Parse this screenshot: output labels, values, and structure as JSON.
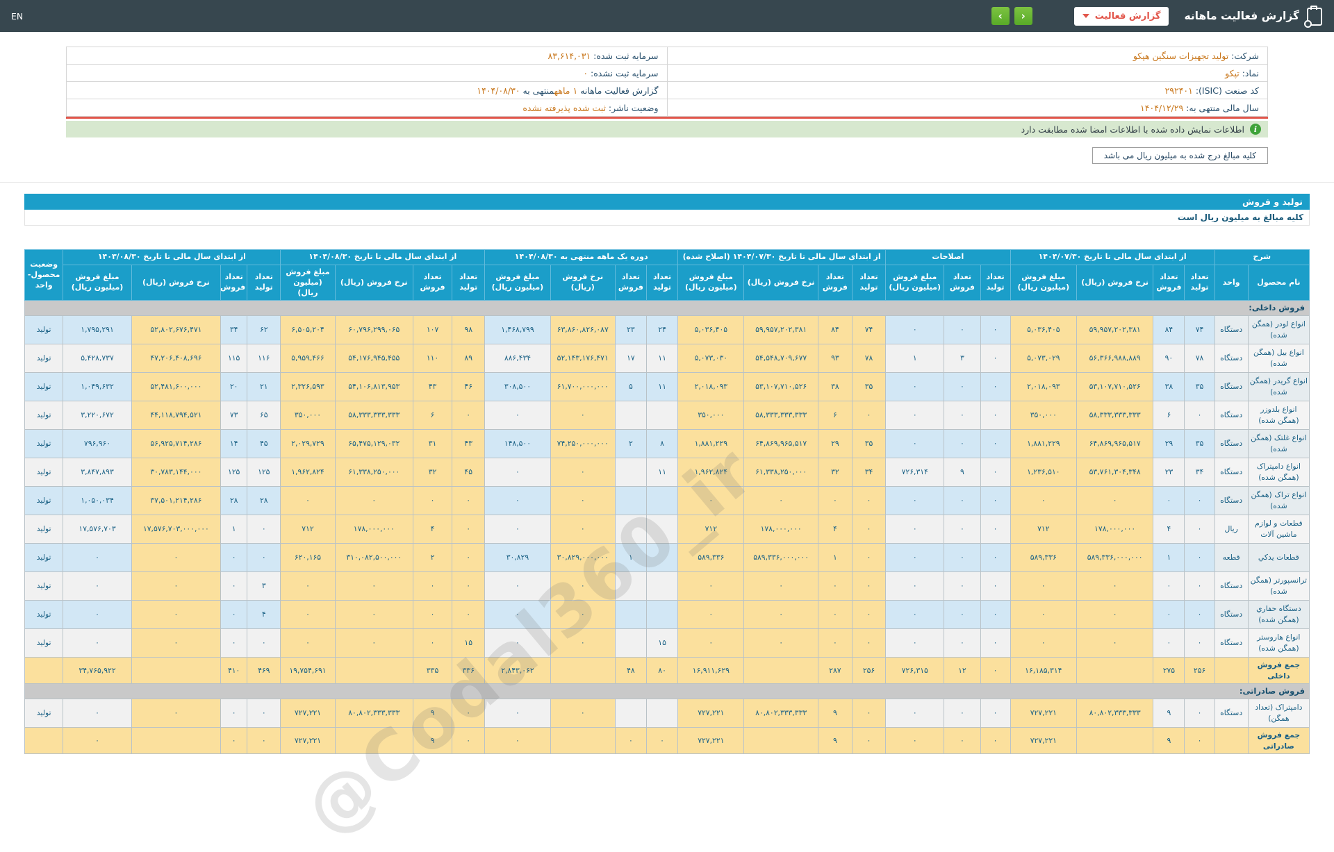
{
  "topbar": {
    "title": "گزارش فعالیت ماهانه",
    "dropdown_label": "گزارش فعالیت",
    "nav_next": "›",
    "nav_prev": "‹",
    "language": "EN"
  },
  "colors": {
    "accent_blue": "#1b9ec9",
    "topbar": "#37474f",
    "wheat": "#fbe09d",
    "row_blue": "#d2e7f5",
    "green_button": "#61b329",
    "red_accent": "#e2574c"
  },
  "company_info": {
    "rows": [
      {
        "right": {
          "key": "company",
          "parts": [
            {
              "k": "lbl",
              "t": "شرکت: "
            },
            {
              "k": "val",
              "t": "تولید تجهیزات سنگین هپکو"
            }
          ]
        },
        "left": {
          "key": "registered-capital",
          "parts": [
            {
              "k": "lbl",
              "t": "سرمایه ثبت شده: "
            },
            {
              "k": "val",
              "t": "۸۳,۶۱۴,۰۳۱"
            }
          ]
        }
      },
      {
        "right": {
          "key": "symbol",
          "parts": [
            {
              "k": "lbl",
              "t": "نماد: "
            },
            {
              "k": "val",
              "t": "تپکو"
            }
          ]
        },
        "left": {
          "key": "unregistered-capital",
          "parts": [
            {
              "k": "lbl",
              "t": "سرمایه ثبت نشده: "
            },
            {
              "k": "val",
              "t": "۰"
            }
          ]
        }
      },
      {
        "right": {
          "key": "isic-code",
          "parts": [
            {
              "k": "lbl",
              "t": "کد صنعت (ISIC): "
            },
            {
              "k": "val",
              "t": "۲۹۲۴۰۱"
            }
          ]
        },
        "left": {
          "key": "report-period",
          "parts": [
            {
              "k": "lbl",
              "t": "گزارش فعالیت ماهانه "
            },
            {
              "k": "val",
              "t": "۱ ماهه"
            },
            {
              "k": "lbl",
              "t": "منتهی به "
            },
            {
              "k": "val",
              "t": "۱۴۰۴/۰۸/۳۰"
            }
          ]
        }
      },
      {
        "right": {
          "key": "fiscal-year-end",
          "parts": [
            {
              "k": "lbl",
              "t": "سال مالی منتهی به: "
            },
            {
              "k": "val",
              "t": "۱۴۰۴/۱۲/۲۹"
            }
          ]
        },
        "left": {
          "key": "publisher-status",
          "parts": [
            {
              "k": "lbl",
              "t": "وضعیت ناشر: "
            },
            {
              "k": "val",
              "t": "ثبت شده پذیرفته نشده"
            }
          ]
        }
      }
    ]
  },
  "banner": {
    "text": "اطلاعات نمایش داده شده با اطلاعات امضا شده مطابقت دارد",
    "icon_glyph": "i"
  },
  "note_box": "کلیه مبالغ درج شده به میلیون ریال می باشد",
  "section_title": "تولید و فروش",
  "section_subtitle": "کلیه مبالغ به میلیون ریال است",
  "watermark": "@Codal360_ir",
  "table": {
    "header": {
      "desc_group": "شرح",
      "product": "نام محصول",
      "unit": "واحد",
      "status": "وضعیت محصول-واحد",
      "cols": {
        "prod": "تعداد تولید",
        "sold": "تعداد فروش",
        "rate": "نرخ فروش (ریال)",
        "amount": "مبلغ فروش (میلیون ریال)"
      },
      "groups": [
        {
          "key": "fy0730",
          "label": "از ابتدای سال مالی تا تاریخ ۱۴۰۴/۰۷/۳۰",
          "cols": 4
        },
        {
          "key": "adj",
          "label": "اصلاحات",
          "cols": 3
        },
        {
          "key": "fy0730c",
          "label": "از ابتدای سال مالی تا تاریخ ۱۴۰۴/۰۷/۳۰ (اصلاح شده)",
          "cols": 4
        },
        {
          "key": "month",
          "label": "دوره یک ماهه منتهی به ۱۴۰۴/۰۸/۳۰",
          "cols": 4
        },
        {
          "key": "fy0830",
          "label": "از ابتدای سال مالی تا تاریخ ۱۴۰۴/۰۸/۳۰",
          "cols": 4
        },
        {
          "key": "py0830",
          "label": "از ابتدای سال مالی تا تاریخ ۱۴۰۳/۰۸/۳۰",
          "cols": 4
        }
      ]
    },
    "rows": [
      {
        "type": "section",
        "name": "فروش داخلی:"
      },
      {
        "type": "data",
        "z": "a",
        "name": "انواع لودر (همگن شده)",
        "unit": "دستگاه",
        "status": "تولید",
        "fy0730": [
          "۷۴",
          "۸۴",
          "۵۹,۹۵۷,۲۰۲,۳۸۱",
          "۵,۰۳۶,۴۰۵"
        ],
        "adj": [
          "۰",
          "۰",
          "۰"
        ],
        "fy0730c": [
          "۷۴",
          "۸۴",
          "۵۹,۹۵۷,۲۰۲,۳۸۱",
          "۵,۰۳۶,۴۰۵"
        ],
        "month": [
          "۲۴",
          "۲۳",
          "۶۳,۸۶۰,۸۲۶,۰۸۷",
          "۱,۴۶۸,۷۹۹"
        ],
        "fy0830": [
          "۹۸",
          "۱۰۷",
          "۶۰,۷۹۶,۲۹۹,۰۶۵",
          "۶,۵۰۵,۲۰۴"
        ],
        "py0830": [
          "۶۲",
          "۳۴",
          "۵۲,۸۰۲,۶۷۶,۴۷۱",
          "۱,۷۹۵,۲۹۱"
        ]
      },
      {
        "type": "data",
        "z": "b",
        "name": "انواع بیل (همگن شده)",
        "unit": "دستگاه",
        "status": "تولید",
        "fy0730": [
          "۷۸",
          "۹۰",
          "۵۶,۳۶۶,۹۸۸,۸۸۹",
          "۵,۰۷۳,۰۲۹"
        ],
        "adj": [
          "۰",
          "۳",
          "۱"
        ],
        "fy0730c": [
          "۷۸",
          "۹۳",
          "۵۴,۵۴۸,۷۰۹,۶۷۷",
          "۵,۰۷۳,۰۳۰"
        ],
        "month": [
          "۱۱",
          "۱۷",
          "۵۲,۱۴۳,۱۷۶,۴۷۱",
          "۸۸۶,۴۳۴"
        ],
        "fy0830": [
          "۸۹",
          "۱۱۰",
          "۵۴,۱۷۶,۹۴۵,۴۵۵",
          "۵,۹۵۹,۴۶۶"
        ],
        "py0830": [
          "۱۱۶",
          "۱۱۵",
          "۴۷,۲۰۶,۴۰۸,۶۹۶",
          "۵,۴۲۸,۷۳۷"
        ]
      },
      {
        "type": "data",
        "z": "a",
        "name": "انواع گریدر (همگن شده)",
        "unit": "دستگاه",
        "status": "تولید",
        "fy0730": [
          "۳۵",
          "۳۸",
          "۵۳,۱۰۷,۷۱۰,۵۲۶",
          "۲,۰۱۸,۰۹۳"
        ],
        "adj": [
          "۰",
          "۰",
          "۰"
        ],
        "fy0730c": [
          "۳۵",
          "۳۸",
          "۵۳,۱۰۷,۷۱۰,۵۲۶",
          "۲,۰۱۸,۰۹۳"
        ],
        "month": [
          "۱۱",
          "۵",
          "۶۱,۷۰۰,۰۰۰,۰۰۰",
          "۳۰۸,۵۰۰"
        ],
        "fy0830": [
          "۴۶",
          "۴۳",
          "۵۴,۱۰۶,۸۱۳,۹۵۳",
          "۲,۳۲۶,۵۹۳"
        ],
        "py0830": [
          "۲۱",
          "۲۰",
          "۵۲,۴۸۱,۶۰۰,۰۰۰",
          "۱,۰۴۹,۶۳۲"
        ]
      },
      {
        "type": "data",
        "z": "b",
        "name": "انواع بلدوزر (همگن شده)",
        "unit": "دستگاه",
        "status": "تولید",
        "fy0730": [
          "۰",
          "۶",
          "۵۸,۳۳۳,۳۳۳,۳۳۳",
          "۳۵۰,۰۰۰"
        ],
        "adj": [
          "۰",
          "۰",
          "۰"
        ],
        "fy0730c": [
          "۰",
          "۶",
          "۵۸,۳۳۳,۳۳۳,۳۳۳",
          "۳۵۰,۰۰۰"
        ],
        "month": [
          "",
          "",
          "۰",
          "۰"
        ],
        "fy0830": [
          "۰",
          "۶",
          "۵۸,۳۳۳,۳۳۳,۳۳۳",
          "۳۵۰,۰۰۰"
        ],
        "py0830": [
          "۶۵",
          "۷۳",
          "۴۴,۱۱۸,۷۹۴,۵۲۱",
          "۳,۲۲۰,۶۷۲"
        ]
      },
      {
        "type": "data",
        "z": "a",
        "name": "انواع غلتک (همگن شده)",
        "unit": "دستگاه",
        "status": "تولید",
        "fy0730": [
          "۳۵",
          "۲۹",
          "۶۴,۸۶۹,۹۶۵,۵۱۷",
          "۱,۸۸۱,۲۲۹"
        ],
        "adj": [
          "۰",
          "۰",
          "۰"
        ],
        "fy0730c": [
          "۳۵",
          "۲۹",
          "۶۴,۸۶۹,۹۶۵,۵۱۷",
          "۱,۸۸۱,۲۲۹"
        ],
        "month": [
          "۸",
          "۲",
          "۷۴,۲۵۰,۰۰۰,۰۰۰",
          "۱۴۸,۵۰۰"
        ],
        "fy0830": [
          "۴۳",
          "۳۱",
          "۶۵,۴۷۵,۱۲۹,۰۳۲",
          "۲,۰۲۹,۷۲۹"
        ],
        "py0830": [
          "۴۵",
          "۱۴",
          "۵۶,۹۲۵,۷۱۴,۲۸۶",
          "۷۹۶,۹۶۰"
        ]
      },
      {
        "type": "data",
        "z": "b",
        "name": "انواع دامپتراک (همگن شده)",
        "unit": "دستگاه",
        "status": "تولید",
        "fy0730": [
          "۳۴",
          "۲۳",
          "۵۳,۷۶۱,۳۰۴,۳۴۸",
          "۱,۲۳۶,۵۱۰"
        ],
        "adj": [
          "۰",
          "۹",
          "۷۲۶,۳۱۴"
        ],
        "fy0730c": [
          "۳۴",
          "۳۲",
          "۶۱,۳۳۸,۲۵۰,۰۰۰",
          "۱,۹۶۲,۸۲۴"
        ],
        "month": [
          "۱۱",
          "",
          "۰",
          "۰"
        ],
        "fy0830": [
          "۴۵",
          "۳۲",
          "۶۱,۳۳۸,۲۵۰,۰۰۰",
          "۱,۹۶۲,۸۲۴"
        ],
        "py0830": [
          "۱۲۵",
          "۱۲۵",
          "۳۰,۷۸۳,۱۴۴,۰۰۰",
          "۳,۸۴۷,۸۹۳"
        ]
      },
      {
        "type": "data",
        "z": "a",
        "name": "انواع تراک (همگن شده)",
        "unit": "دستگاه",
        "status": "تولید",
        "fy0730": [
          "۰",
          "۰",
          "۰",
          "۰"
        ],
        "adj": [
          "۰",
          "۰",
          "۰"
        ],
        "fy0730c": [
          "۰",
          "۰",
          "۰",
          "۰"
        ],
        "month": [
          "",
          "",
          "۰",
          "۰"
        ],
        "fy0830": [
          "۰",
          "۰",
          "۰",
          "۰"
        ],
        "py0830": [
          "۲۸",
          "۲۸",
          "۳۷,۵۰۱,۲۱۴,۲۸۶",
          "۱,۰۵۰,۰۳۴"
        ]
      },
      {
        "type": "data",
        "z": "b",
        "name": "قطعات و لوازم ماشین آلات",
        "unit": "ریال",
        "status": "تولید",
        "fy0730": [
          "۰",
          "۴",
          "۱۷۸,۰۰۰,۰۰۰",
          "۷۱۲"
        ],
        "adj": [
          "۰",
          "۰",
          "۰"
        ],
        "fy0730c": [
          "۰",
          "۴",
          "۱۷۸,۰۰۰,۰۰۰",
          "۷۱۲"
        ],
        "month": [
          "",
          "",
          "۰",
          "۰"
        ],
        "fy0830": [
          "۰",
          "۴",
          "۱۷۸,۰۰۰,۰۰۰",
          "۷۱۲"
        ],
        "py0830": [
          "۰",
          "۱",
          "۱۷,۵۷۶,۷۰۳,۰۰۰,۰۰۰",
          "۱۷,۵۷۶,۷۰۳"
        ]
      },
      {
        "type": "data",
        "z": "a",
        "name": "قطعات یدکي",
        "unit": "قطعه",
        "status": "تولید",
        "fy0730": [
          "۰",
          "۱",
          "۵۸۹,۳۳۶,۰۰۰,۰۰۰",
          "۵۸۹,۳۳۶"
        ],
        "adj": [
          "۰",
          "۰",
          "۰"
        ],
        "fy0730c": [
          "۰",
          "۱",
          "۵۸۹,۳۳۶,۰۰۰,۰۰۰",
          "۵۸۹,۳۳۶"
        ],
        "month": [
          "",
          "۱",
          "۳۰,۸۲۹,۰۰۰,۰۰۰",
          "۳۰,۸۲۹"
        ],
        "fy0830": [
          "۰",
          "۲",
          "۳۱۰,۰۸۲,۵۰۰,۰۰۰",
          "۶۲۰,۱۶۵"
        ],
        "py0830": [
          "۰",
          "۰",
          "۰",
          "۰"
        ]
      },
      {
        "type": "data",
        "z": "b",
        "name": "ترانسپورتر (همگن شده)",
        "unit": "دستگاه",
        "status": "تولید",
        "fy0730": [
          "۰",
          "۰",
          "۰",
          "۰"
        ],
        "adj": [
          "۰",
          "۰",
          "۰"
        ],
        "fy0730c": [
          "۰",
          "۰",
          "۰",
          "۰"
        ],
        "month": [
          "",
          "",
          "۰",
          "۰"
        ],
        "fy0830": [
          "۰",
          "۰",
          "۰",
          "۰"
        ],
        "py0830": [
          "۳",
          "۰",
          "۰",
          "۰"
        ]
      },
      {
        "type": "data",
        "z": "a",
        "name": "دستگاه حفاري (همگن شده)",
        "unit": "دستگاه",
        "status": "تولید",
        "fy0730": [
          "۰",
          "۰",
          "۰",
          "۰"
        ],
        "adj": [
          "۰",
          "۰",
          "۰"
        ],
        "fy0730c": [
          "۰",
          "۰",
          "۰",
          "۰"
        ],
        "month": [
          "",
          "",
          "۰",
          "۰"
        ],
        "fy0830": [
          "۰",
          "۰",
          "۰",
          "۰"
        ],
        "py0830": [
          "۴",
          "۰",
          "۰",
          "۰"
        ]
      },
      {
        "type": "data",
        "z": "b",
        "name": "انواع هاروستر (همگن شده)",
        "unit": "دستگاه",
        "status": "تولید",
        "fy0730": [
          "۰",
          "۰",
          "۰",
          "۰"
        ],
        "adj": [
          "۰",
          "۰",
          "۰"
        ],
        "fy0730c": [
          "۰",
          "۰",
          "۰",
          "۰"
        ],
        "month": [
          "۱۵",
          "",
          "۰",
          "۰"
        ],
        "fy0830": [
          "۱۵",
          "۰",
          "۰",
          "۰"
        ],
        "py0830": [
          "۰",
          "۰",
          "۰",
          "۰"
        ]
      },
      {
        "type": "total",
        "name": "جمع فروش داخلی",
        "unit": "",
        "status": "",
        "fy0730": [
          "۲۵۶",
          "۲۷۵",
          "",
          "۱۶,۱۸۵,۳۱۴"
        ],
        "adj": [
          "۰",
          "۱۲",
          "۷۲۶,۳۱۵"
        ],
        "fy0730c": [
          "۲۵۶",
          "۲۸۷",
          "",
          "۱۶,۹۱۱,۶۲۹"
        ],
        "month": [
          "۸۰",
          "۴۸",
          "",
          "۲,۸۴۳,۰۶۲"
        ],
        "fy0830": [
          "۳۳۶",
          "۳۳۵",
          "",
          "۱۹,۷۵۴,۶۹۱"
        ],
        "py0830": [
          "۴۶۹",
          "۴۱۰",
          "",
          "۳۴,۷۶۵,۹۲۲"
        ]
      },
      {
        "type": "section",
        "name": "فروش صادراتی:"
      },
      {
        "type": "data",
        "z": "b",
        "name": "دامپتراک (تعداد همگن)",
        "unit": "دستگاه",
        "status": "تولید",
        "fy0730": [
          "۰",
          "۹",
          "۸۰,۸۰۲,۳۳۳,۳۳۳",
          "۷۲۷,۲۲۱"
        ],
        "adj": [
          "۰",
          "۰",
          "۰"
        ],
        "fy0730c": [
          "۰",
          "۹",
          "۸۰,۸۰۲,۳۳۳,۳۳۳",
          "۷۲۷,۲۲۱"
        ],
        "month": [
          "",
          "",
          "۰",
          "۰"
        ],
        "fy0830": [
          "۰",
          "۹",
          "۸۰,۸۰۲,۳۳۳,۳۳۳",
          "۷۲۷,۲۲۱"
        ],
        "py0830": [
          "۰",
          "۰",
          "۰",
          "۰"
        ]
      },
      {
        "type": "total",
        "name": "جمع فروش صادراتی",
        "unit": "",
        "status": "",
        "fy0730": [
          "۰",
          "۹",
          "",
          "۷۲۷,۲۲۱"
        ],
        "adj": [
          "۰",
          "۰",
          "۰"
        ],
        "fy0730c": [
          "۰",
          "۹",
          "",
          "۷۲۷,۲۲۱"
        ],
        "month": [
          "۰",
          "۰",
          "",
          "۰"
        ],
        "fy0830": [
          "۰",
          "۹",
          "",
          "۷۲۷,۲۲۱"
        ],
        "py0830": [
          "۰",
          "۰",
          "",
          "۰"
        ]
      }
    ]
  }
}
